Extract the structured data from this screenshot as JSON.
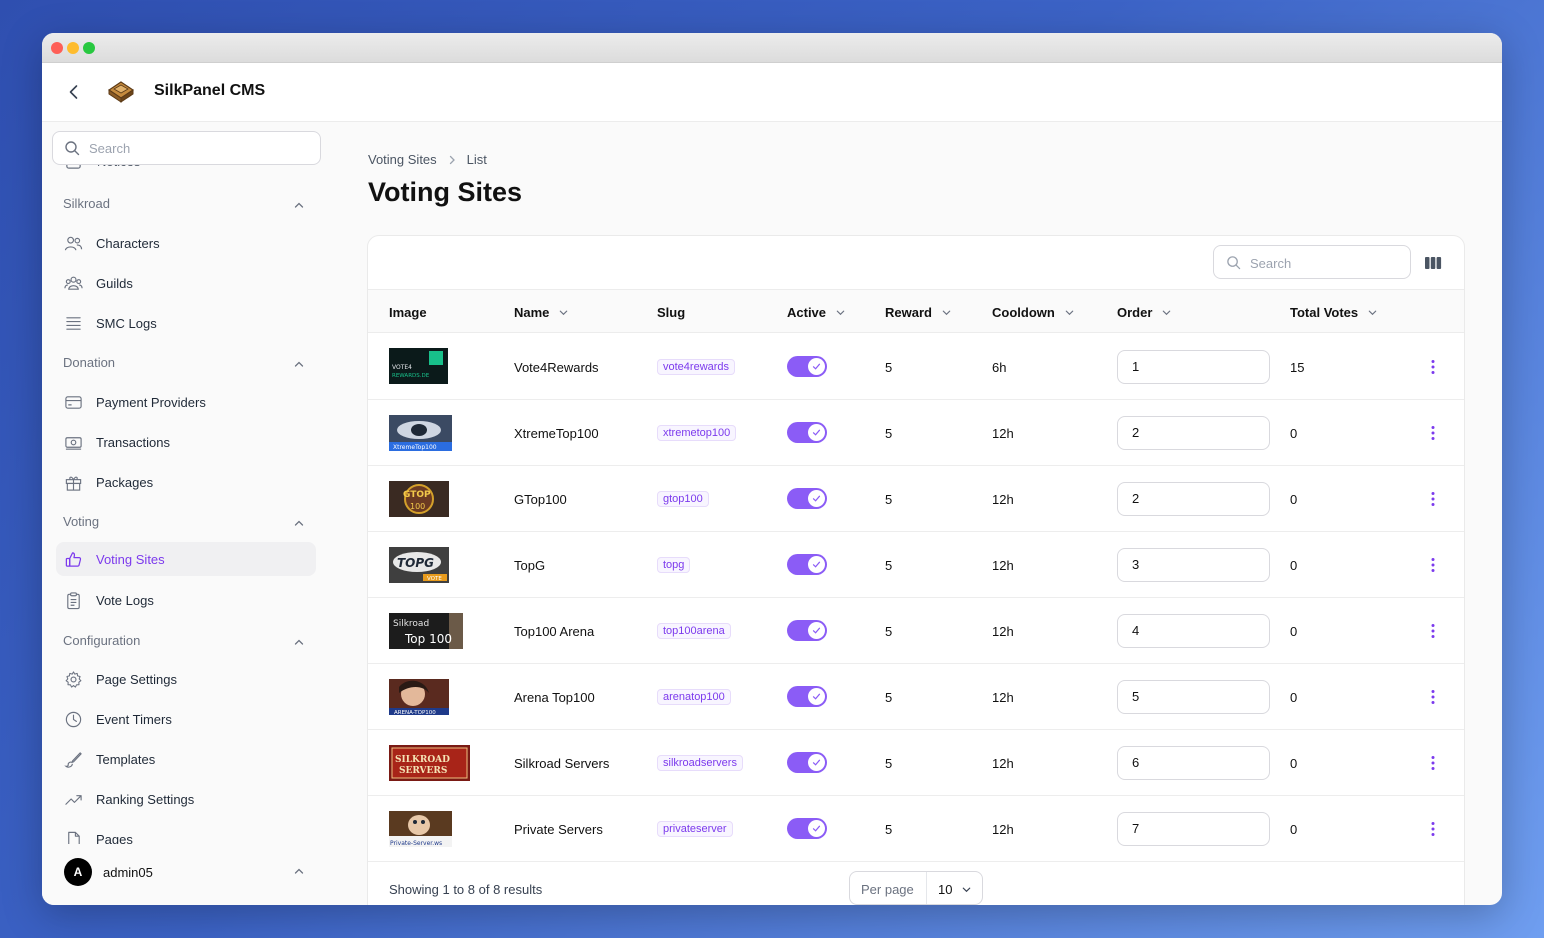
{
  "app": {
    "title": "SilkPanel CMS"
  },
  "sidebar": {
    "search_placeholder": "Search",
    "clipped_item": "Notices",
    "groups": [
      {
        "label": "Silkroad",
        "items": [
          {
            "label": "Characters",
            "icon": "users-icon"
          },
          {
            "label": "Guilds",
            "icon": "user-group-icon"
          },
          {
            "label": "SMC Logs",
            "icon": "list-icon"
          }
        ]
      },
      {
        "label": "Donation",
        "items": [
          {
            "label": "Payment Providers",
            "icon": "credit-card-icon"
          },
          {
            "label": "Transactions",
            "icon": "banknotes-icon"
          },
          {
            "label": "Packages",
            "icon": "gift-icon"
          }
        ]
      },
      {
        "label": "Voting",
        "items": [
          {
            "label": "Voting Sites",
            "icon": "thumb-up-icon",
            "active": true
          },
          {
            "label": "Vote Logs",
            "icon": "clipboard-icon"
          }
        ]
      },
      {
        "label": "Configuration",
        "items": [
          {
            "label": "Page Settings",
            "icon": "gear-icon"
          },
          {
            "label": "Event Timers",
            "icon": "clock-icon"
          },
          {
            "label": "Templates",
            "icon": "paintbrush-icon"
          },
          {
            "label": "Ranking Settings",
            "icon": "trending-icon"
          },
          {
            "label": "Pages",
            "icon": "document-icon"
          }
        ]
      }
    ],
    "user": {
      "initial": "A",
      "name": "admin05"
    }
  },
  "breadcrumb": {
    "parent": "Voting Sites",
    "current": "List"
  },
  "page": {
    "title": "Voting Sites"
  },
  "table": {
    "search_placeholder": "Search",
    "columns": [
      "Image",
      "Name",
      "Slug",
      "Active",
      "Reward",
      "Cooldown",
      "Order",
      "Total Votes"
    ],
    "rows": [
      {
        "name": "Vote4Rewards",
        "slug": "vote4rewards",
        "active": true,
        "reward": "5",
        "cooldown": "6h",
        "order": "1",
        "total_votes": "15",
        "image_text": "VOTE4 REWARDS.DE"
      },
      {
        "name": "XtremeTop100",
        "slug": "xtremetop100",
        "active": true,
        "reward": "5",
        "cooldown": "12h",
        "order": "2",
        "total_votes": "0",
        "image_text": "XtremeTop100"
      },
      {
        "name": "GTop100",
        "slug": "gtop100",
        "active": true,
        "reward": "5",
        "cooldown": "12h",
        "order": "2",
        "total_votes": "0",
        "image_text": "GTOP 100"
      },
      {
        "name": "TopG",
        "slug": "topg",
        "active": true,
        "reward": "5",
        "cooldown": "12h",
        "order": "3",
        "total_votes": "0",
        "image_text": "TOPG VOTE"
      },
      {
        "name": "Top100 Arena",
        "slug": "top100arena",
        "active": true,
        "reward": "5",
        "cooldown": "12h",
        "order": "4",
        "total_votes": "0",
        "image_text": "Silkroad Top 100"
      },
      {
        "name": "Arena Top100",
        "slug": "arenatop100",
        "active": true,
        "reward": "5",
        "cooldown": "12h",
        "order": "5",
        "total_votes": "0",
        "image_text": "ARENA-TOP100"
      },
      {
        "name": "Silkroad Servers",
        "slug": "silkroadservers",
        "active": true,
        "reward": "5",
        "cooldown": "12h",
        "order": "6",
        "total_votes": "0",
        "image_text": "SILKROAD SERVERS"
      },
      {
        "name": "Private Servers",
        "slug": "privateserver",
        "active": true,
        "reward": "5",
        "cooldown": "12h",
        "order": "7",
        "total_votes": "0",
        "image_text": "Private-Server.ws"
      }
    ],
    "footer": {
      "results": "Showing 1 to 8 of 8 results",
      "per_page_label": "Per page",
      "per_page_value": "10"
    }
  },
  "colors": {
    "accent": "#8b5cf6",
    "accent_text": "#7c3aed"
  }
}
